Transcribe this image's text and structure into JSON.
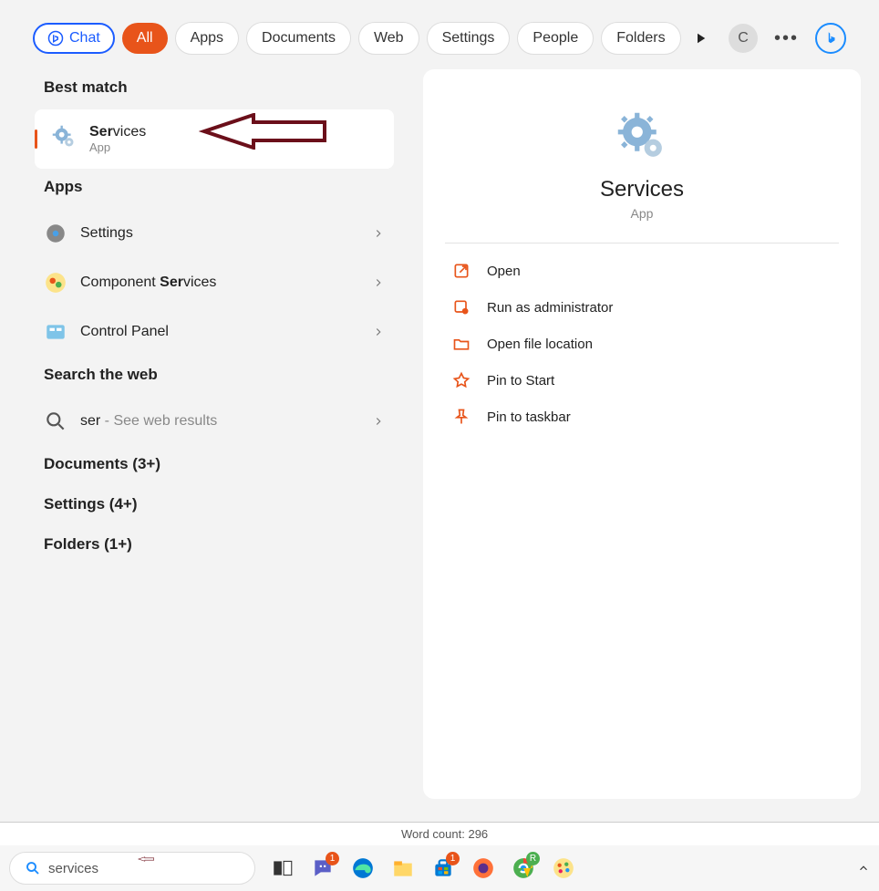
{
  "tabs": {
    "chat": "Chat",
    "all": "All",
    "apps": "Apps",
    "documents": "Documents",
    "web": "Web",
    "settings": "Settings",
    "people": "People",
    "folders": "Folders"
  },
  "avatar_letter": "C",
  "sections": {
    "best_match": "Best match",
    "apps": "Apps",
    "search_web": "Search the web",
    "documents": "Documents (3+)",
    "settings": "Settings (4+)",
    "folders": "Folders (1+)"
  },
  "best_match": {
    "title_bold": "Ser",
    "title_rest": "vices",
    "subtitle": "App"
  },
  "app_items": [
    {
      "label_pre": "",
      "label_bold": "",
      "label_post": "Settings"
    },
    {
      "label_pre": "Component ",
      "label_bold": "Ser",
      "label_post": "vices"
    },
    {
      "label_pre": "",
      "label_bold": "",
      "label_post": "Control Panel"
    }
  ],
  "web_item": {
    "query": "ser",
    "hint": " - See web results"
  },
  "preview": {
    "title": "Services",
    "subtitle": "App"
  },
  "actions": [
    "Open",
    "Run as administrator",
    "Open file location",
    "Pin to Start",
    "Pin to taskbar"
  ],
  "background": {
    "word_count": "Word count: 296"
  },
  "search_value": "services",
  "taskbar_badges": {
    "chat": "1",
    "store": "1",
    "chrome": "R"
  }
}
